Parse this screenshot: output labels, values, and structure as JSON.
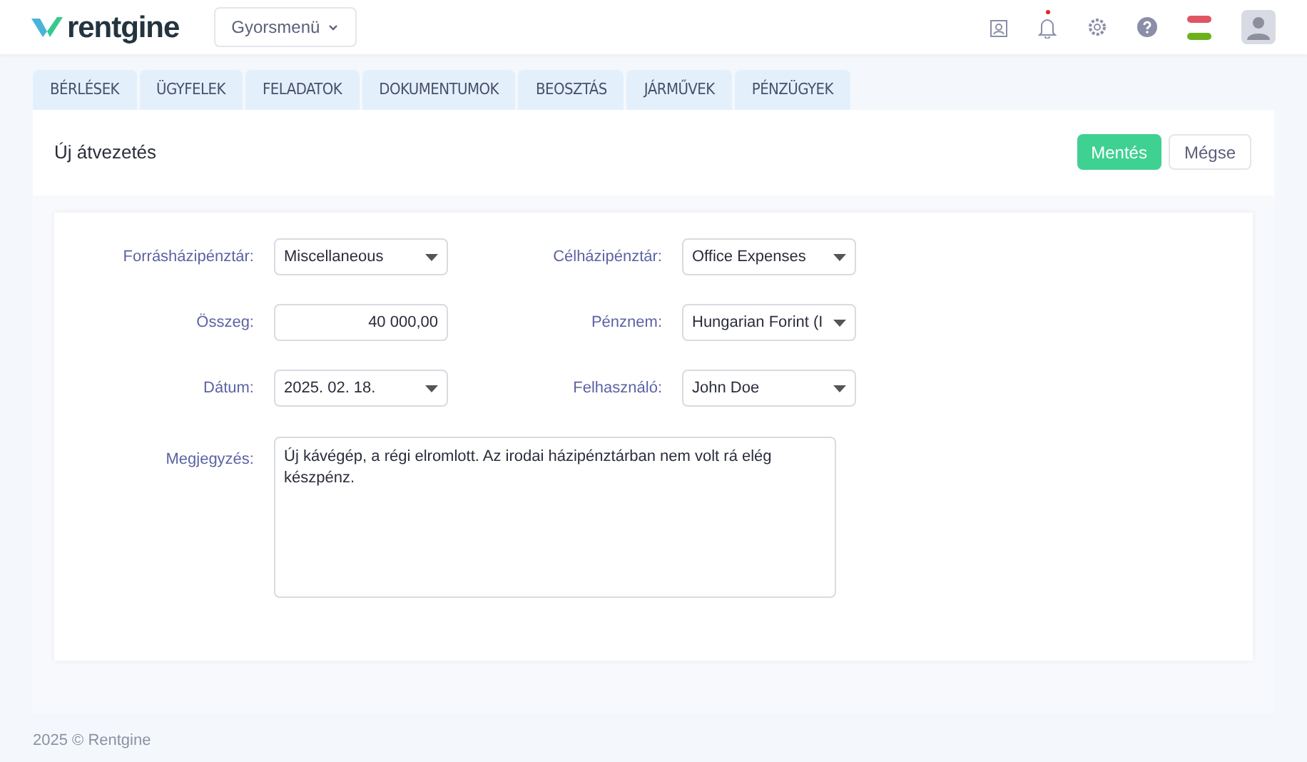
{
  "header": {
    "logo": "rentgine",
    "quick_menu": "Gyorsmenü",
    "notification_dot": true
  },
  "tabs": [
    {
      "label": "BÉRLÉSEK",
      "selected": false
    },
    {
      "label": "ÜGYFELEK",
      "selected": false
    },
    {
      "label": "FELADATOK",
      "selected": false
    },
    {
      "label": "DOKUMENTUMOK",
      "selected": false
    },
    {
      "label": "BEOSZTÁS",
      "selected": false
    },
    {
      "label": "JÁRMŰVEK",
      "selected": false
    },
    {
      "label": "PÉNZÜGYEK",
      "selected": false
    }
  ],
  "page": {
    "title": "Új átvezetés",
    "buttons": [
      {
        "label": "Mentés",
        "kind": "primary"
      },
      {
        "label": "Mégse",
        "kind": "secondary"
      }
    ]
  },
  "form": {
    "fields": [
      {
        "label": "Forrásházipénztár:",
        "value": "Miscellaneous",
        "kind": "select"
      },
      {
        "label": "Célházipénztár:",
        "value": "Office Expenses",
        "kind": "select"
      },
      {
        "label": "Összeg:",
        "value": "40 000,00",
        "kind": "number"
      },
      {
        "label": "Pénznem:",
        "value": "Hungarian Forint (I",
        "kind": "select"
      },
      {
        "label": "Dátum:",
        "value": "2025. 02. 18.",
        "kind": "select"
      },
      {
        "label": "Felhasználó:",
        "value": "John Doe",
        "kind": "select"
      }
    ],
    "note": {
      "label": "Megjegyzés:",
      "value": "Új kávégép, a régi elromlott. Az irodai házipénztárban nem volt rá elég készpénz."
    }
  },
  "footer": "2025 © Rentgine"
}
